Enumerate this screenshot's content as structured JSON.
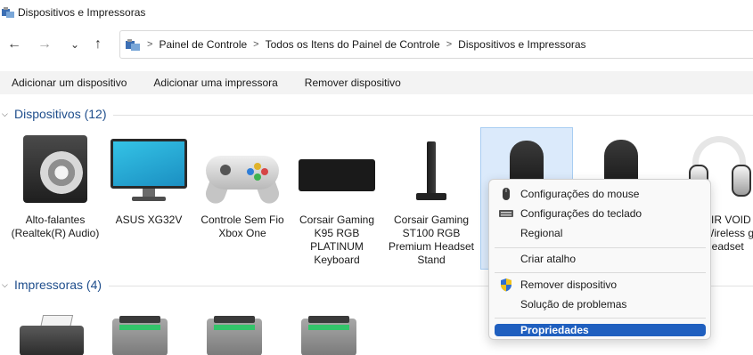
{
  "window": {
    "title": "Dispositivos e Impressoras"
  },
  "nav": {
    "back": "←",
    "forward": "→",
    "expand": "⌄",
    "up": "↑"
  },
  "breadcrumb": [
    "Painel de Controle",
    "Todos os Itens do Painel de Controle",
    "Dispositivos e Impressoras"
  ],
  "toolbar": {
    "add_device": "Adicionar um dispositivo",
    "add_printer": "Adicionar uma impressora",
    "remove_device": "Remover dispositivo"
  },
  "sections": {
    "devices": "Dispositivos (12)",
    "printers": "Impressoras (4)"
  },
  "devices": [
    {
      "name": "Alto-falantes (Realtek(R) Audio)",
      "icon": "speaker-icon"
    },
    {
      "name": "ASUS XG32V",
      "icon": "monitor-icon"
    },
    {
      "name": "Controle Sem Fio Xbox One",
      "icon": "gamepad-icon"
    },
    {
      "name": "Corsair Gaming K95 RGB PLATINUM Keyboard",
      "icon": "keyboard-icon"
    },
    {
      "name": "Corsair Gaming ST100 RGB Premium Headset Stand",
      "icon": "headset-stand-icon"
    },
    {
      "name": "",
      "icon": "mouse-icon",
      "selected": true
    },
    {
      "name": "",
      "icon": "mouse-icon"
    },
    {
      "name": "AIR VOID Wireless g Headset",
      "icon": "headset-icon"
    }
  ],
  "context_menu": {
    "items": [
      {
        "label": "Configurações do mouse",
        "icon": "mouse-icon"
      },
      {
        "label": "Configurações do teclado",
        "icon": "keyboard-icon"
      },
      {
        "label": "Regional",
        "icon": ""
      },
      {
        "label": "Criar atalho",
        "icon": ""
      },
      {
        "label": "Remover dispositivo",
        "icon": "shield-icon"
      },
      {
        "label": "Solução de problemas",
        "icon": ""
      },
      {
        "label": "Propriedades",
        "icon": ""
      }
    ]
  },
  "colors": {
    "section_title": "#1f4e8c",
    "selection_bg": "#dbeafb",
    "menu_highlight": "#1f5fbf",
    "printer_status": "#33c46a"
  }
}
